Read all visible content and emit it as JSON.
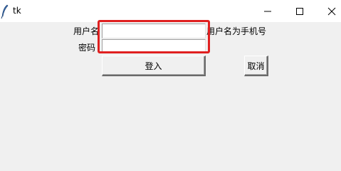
{
  "window": {
    "title": "tk",
    "icon": "tk-feather-icon",
    "controls": {
      "minimize_icon": "minimize-icon",
      "maximize_icon": "maximize-icon",
      "close_icon": "close-icon"
    }
  },
  "form": {
    "username_label": "用户名",
    "password_label": "密码",
    "username_hint": "用户名为手机号",
    "username_value": "",
    "password_value": "",
    "login_button": "登入",
    "cancel_button": "取消"
  },
  "highlight": {
    "color": "#e02020"
  }
}
